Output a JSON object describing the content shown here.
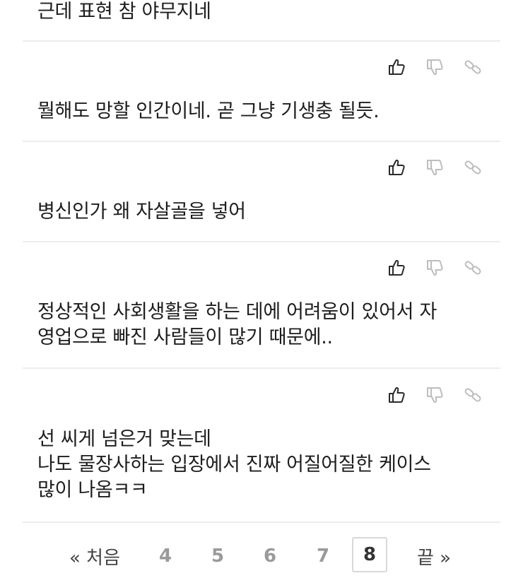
{
  "comments": [
    {
      "text": "근데 표현 참 야무지네"
    },
    {
      "text": "뭘해도 망할 인간이네. 곧 그냥 기생충 될듯."
    },
    {
      "text": "병신인가 왜 자살골을 넣어"
    },
    {
      "text": "정상적인 사회생활을 하는 데에 어려움이 있어서 자\n영업으로 빠진 사람들이 많기 때문에.."
    },
    {
      "text": "선 씨게 넘은거 맞는데\n나도 물장사하는 입장에서 진짜 어질어질한 케이스\n많이 나옴ㅋㅋ"
    }
  ],
  "icons": {
    "like": "thumbs-up-icon",
    "dislike": "thumbs-down-icon",
    "link": "link-icon"
  },
  "pagination": {
    "first_label": "« 처음",
    "pages": [
      "4",
      "5",
      "6",
      "7",
      "8"
    ],
    "current": "8",
    "last_label": "끝 »"
  },
  "colors": {
    "divider": "#ececec",
    "icon_dark": "#2b2b2b",
    "icon_light": "#bdbdbd",
    "page_inactive": "#9a9a9a"
  }
}
